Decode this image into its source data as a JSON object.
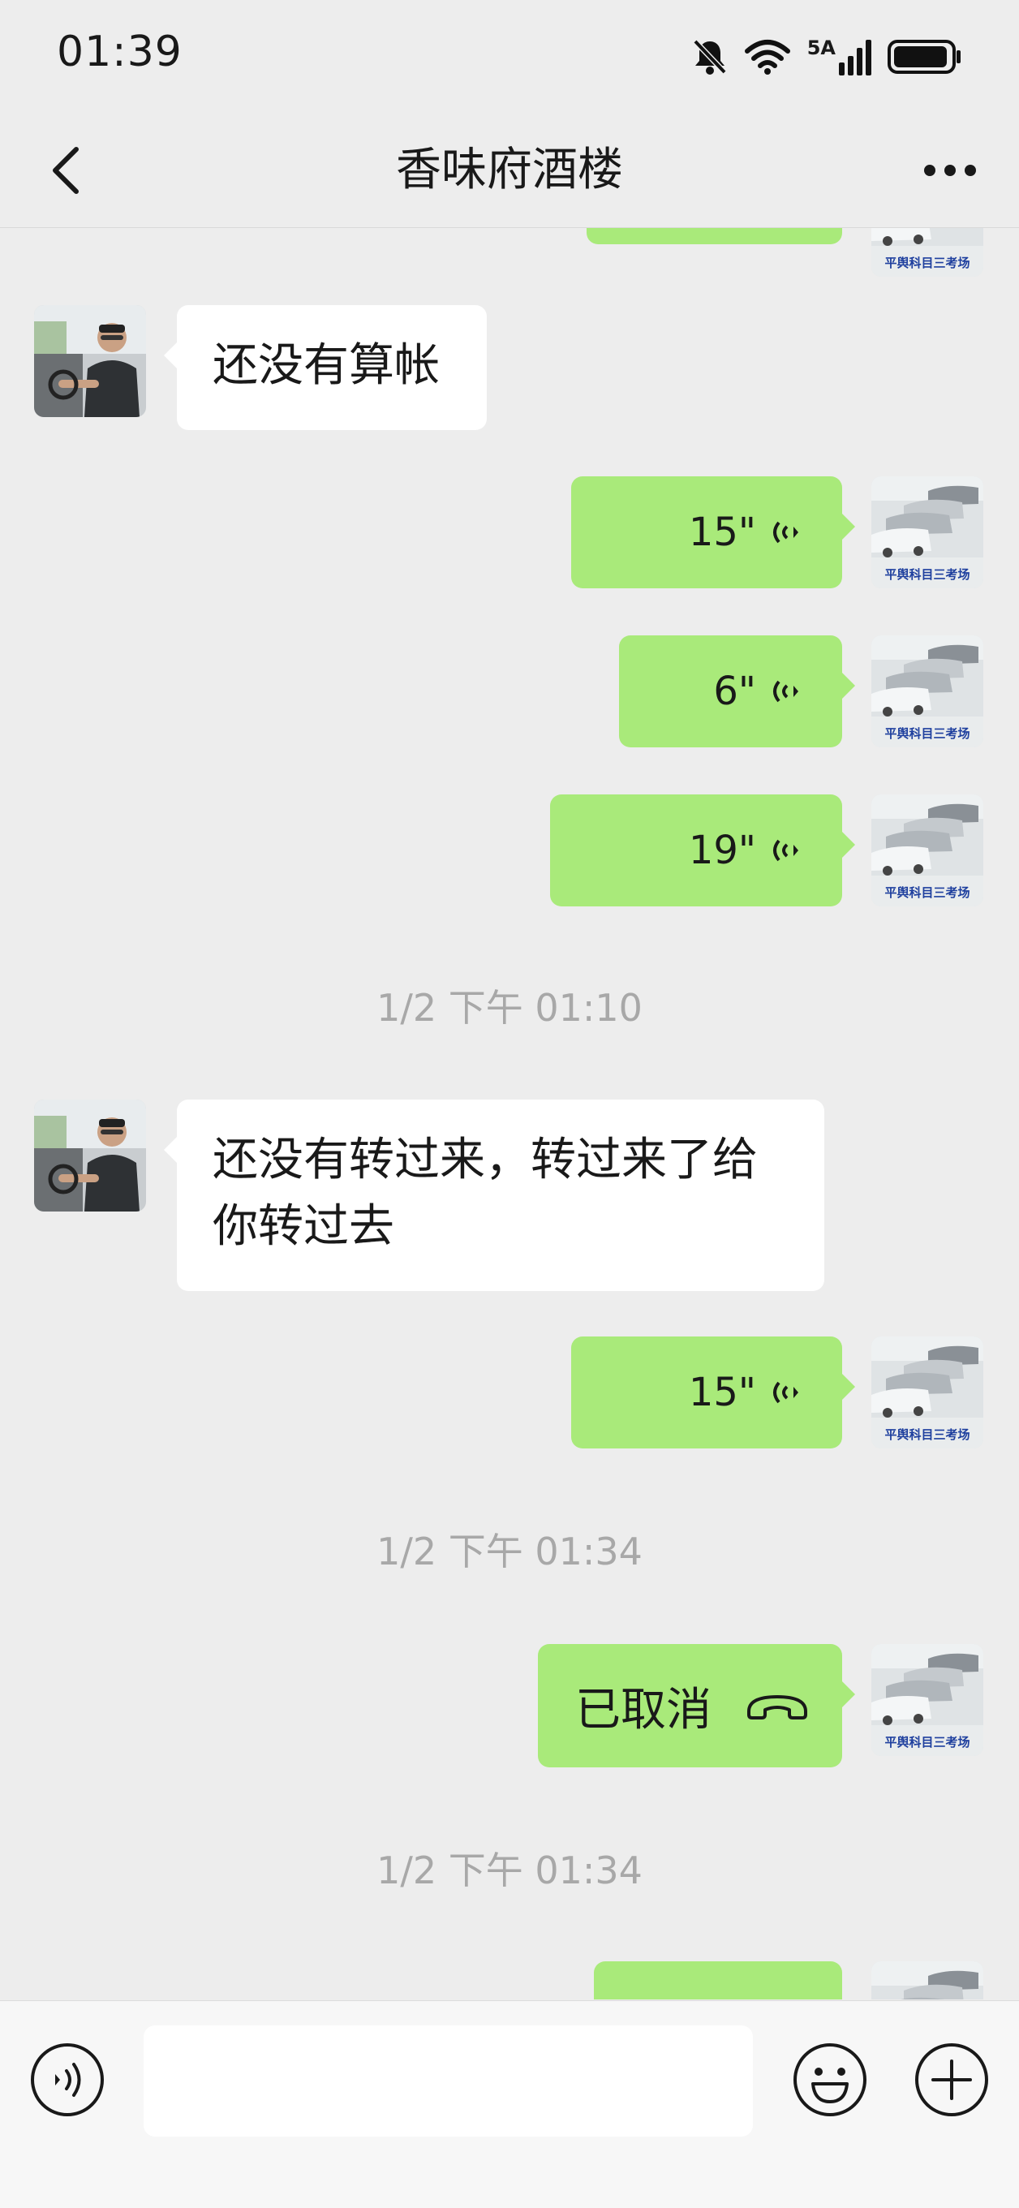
{
  "status_bar": {
    "time": "01:39",
    "network_label": "5A",
    "battery_level": 0.95
  },
  "nav": {
    "title": "香味府酒楼",
    "back_icon": "chevron-left-icon",
    "more_icon": "more-dots-icon"
  },
  "messages": {
    "m1": {
      "text": "还没有算帐"
    },
    "v1": {
      "duration": "15\""
    },
    "v2": {
      "duration": "6\""
    },
    "v3": {
      "duration": "19\""
    },
    "ts1": "1/2 下午 01:10",
    "m2": {
      "text": "还没有转过来，转过来了给你转过去"
    },
    "v4": {
      "duration": "15\""
    },
    "ts2": "1/2 下午 01:34",
    "call": {
      "text": "已取消"
    },
    "ts3": "1/2 下午 01:34"
  },
  "avatars": {
    "contact_caption": "",
    "self_caption": "平舆科目三考场"
  },
  "input_bar": {
    "placeholder": "",
    "voice_icon": "voice-icon",
    "emoji_icon": "emoji-icon",
    "plus_icon": "plus-icon"
  },
  "colors": {
    "background": "#ededed",
    "outgoing_bubble": "#a9ea7a",
    "incoming_bubble": "#ffffff",
    "timestamp": "#a8a8a8"
  }
}
